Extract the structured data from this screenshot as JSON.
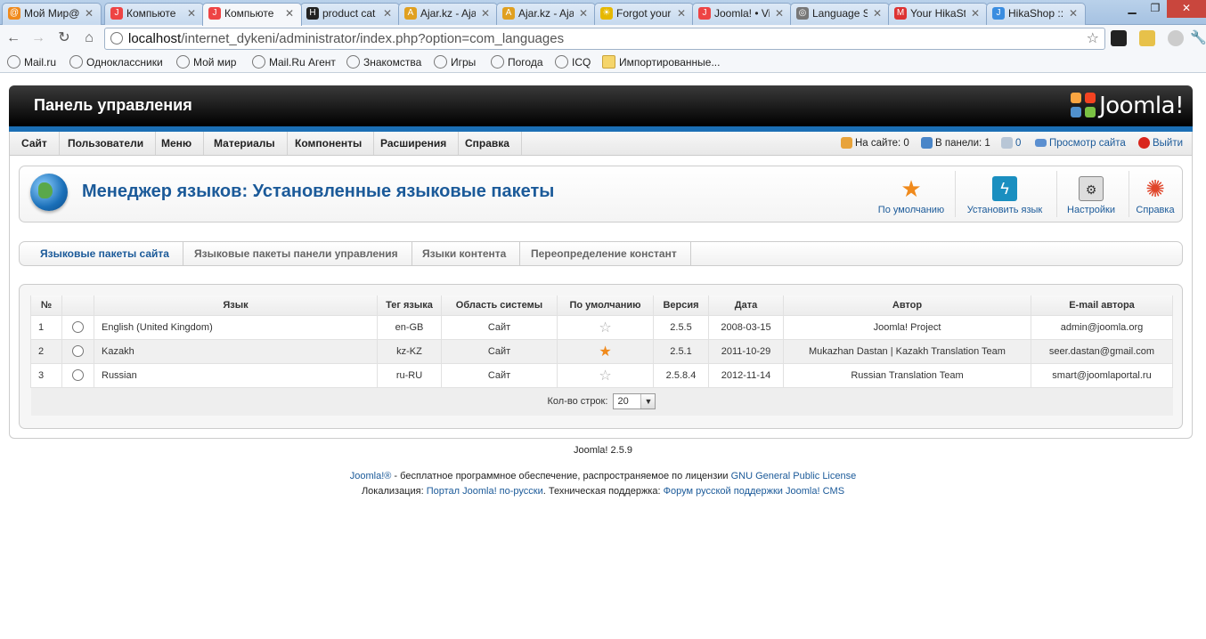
{
  "browser": {
    "tabs": [
      {
        "title": "Мой Мир@",
        "favicon": "mailru-mymir-icon",
        "color": "#f08a1c"
      },
      {
        "title": "Компьюте",
        "favicon": "joomla-icon",
        "color": "#e44"
      },
      {
        "title": "Компьюте",
        "favicon": "joomla-icon",
        "color": "#e44"
      },
      {
        "title": "product cat",
        "favicon": "hikashop-icon",
        "color": "#222"
      },
      {
        "title": "Ajar.kz - Aja",
        "favicon": "ajar-icon",
        "color": "#e0a020"
      },
      {
        "title": "Ajar.kz - Aja",
        "favicon": "ajar-icon",
        "color": "#e0a020"
      },
      {
        "title": "Forgot your",
        "favicon": "sun-icon",
        "color": "#e6b800"
      },
      {
        "title": "Joomla! • Vi",
        "favicon": "joomla-icon",
        "color": "#e44"
      },
      {
        "title": "Language S",
        "favicon": "globe-icon",
        "color": "#777"
      },
      {
        "title": "Your HikaSt",
        "favicon": "gmail-icon",
        "color": "#d33"
      },
      {
        "title": "HikaShop ::",
        "favicon": "joomla-icon",
        "color": "#3a8de0"
      }
    ],
    "active_tab_index": 2,
    "url_host": "localhost",
    "url_path": "/internet_dykeni/administrator/index.php?option=com_languages",
    "bookmarks": [
      "Mail.ru",
      "Одноклассники",
      "Мой мир",
      "Mail.Ru Агент",
      "Знакомства",
      "Игры",
      "Погода",
      "ICQ",
      "Импортированные..."
    ]
  },
  "header": {
    "title": "Панель управления",
    "logo_text": "Joomla!"
  },
  "menu": {
    "items": [
      "Сайт",
      "Пользователи",
      "Меню",
      "Материалы",
      "Компоненты",
      "Расширения",
      "Справка"
    ],
    "status": {
      "on_site": "На сайте: 0",
      "in_panel": "В панели: 1",
      "messages": "0",
      "view_site": "Просмотр сайта",
      "logout": "Выйти"
    }
  },
  "toolbar": {
    "page_title": "Менеджер языков: Установленные языковые пакеты",
    "buttons": [
      {
        "label": "По умолчанию",
        "icon": "star-icon"
      },
      {
        "label": "Установить язык",
        "icon": "install-icon"
      },
      {
        "label": "Настройки",
        "icon": "options-icon"
      },
      {
        "label": "Справка",
        "icon": "help-lifebuoy-icon"
      }
    ]
  },
  "subtabs": [
    "Языковые пакеты сайта",
    "Языковые пакеты панели управления",
    "Языки контента",
    "Переопределение констант"
  ],
  "table": {
    "headers": [
      "№",
      "",
      "Язык",
      "Тег языка",
      "Область системы",
      "По умолчанию",
      "Версия",
      "Дата",
      "Автор",
      "E-mail автора"
    ],
    "rows": [
      {
        "num": "1",
        "language": "English (United Kingdom)",
        "tag": "en-GB",
        "client": "Сайт",
        "default": false,
        "version": "2.5.5",
        "date": "2008-03-15",
        "author": "Joomla! Project",
        "email": "admin@joomla.org"
      },
      {
        "num": "2",
        "language": "Kazakh",
        "tag": "kz-KZ",
        "client": "Сайт",
        "default": true,
        "version": "2.5.1",
        "date": "2011-10-29",
        "author": "Mukazhan Dastan | Kazakh Translation Team",
        "email": "seer.dastan@gmail.com"
      },
      {
        "num": "3",
        "language": "Russian",
        "tag": "ru-RU",
        "client": "Сайт",
        "default": false,
        "version": "2.5.8.4",
        "date": "2012-11-14",
        "author": "Russian Translation Team",
        "email": "smart@joomlaportal.ru"
      }
    ],
    "rows_label": "Кол-во строк:",
    "rows_value": "20"
  },
  "footer": {
    "version": "Joomla! 2.5.9",
    "line1_link1": "Joomla!®",
    "line1_text": " - бесплатное программное обеспечение, распространяемое по лицензии ",
    "line1_link2": "GNU General Public License",
    "line2_text1": "Локализация: ",
    "line2_link1": "Портал Joomla! по-русски",
    "line2_text2": ". Техническая поддержка: ",
    "line2_link2": "Форум русской поддержки Joomla! CMS"
  },
  "colors": {
    "brand_blue": "#1b5a99",
    "header_bar": "#000000",
    "accent_bar": "#1b6fb5",
    "default_star": "#f08a1c"
  }
}
